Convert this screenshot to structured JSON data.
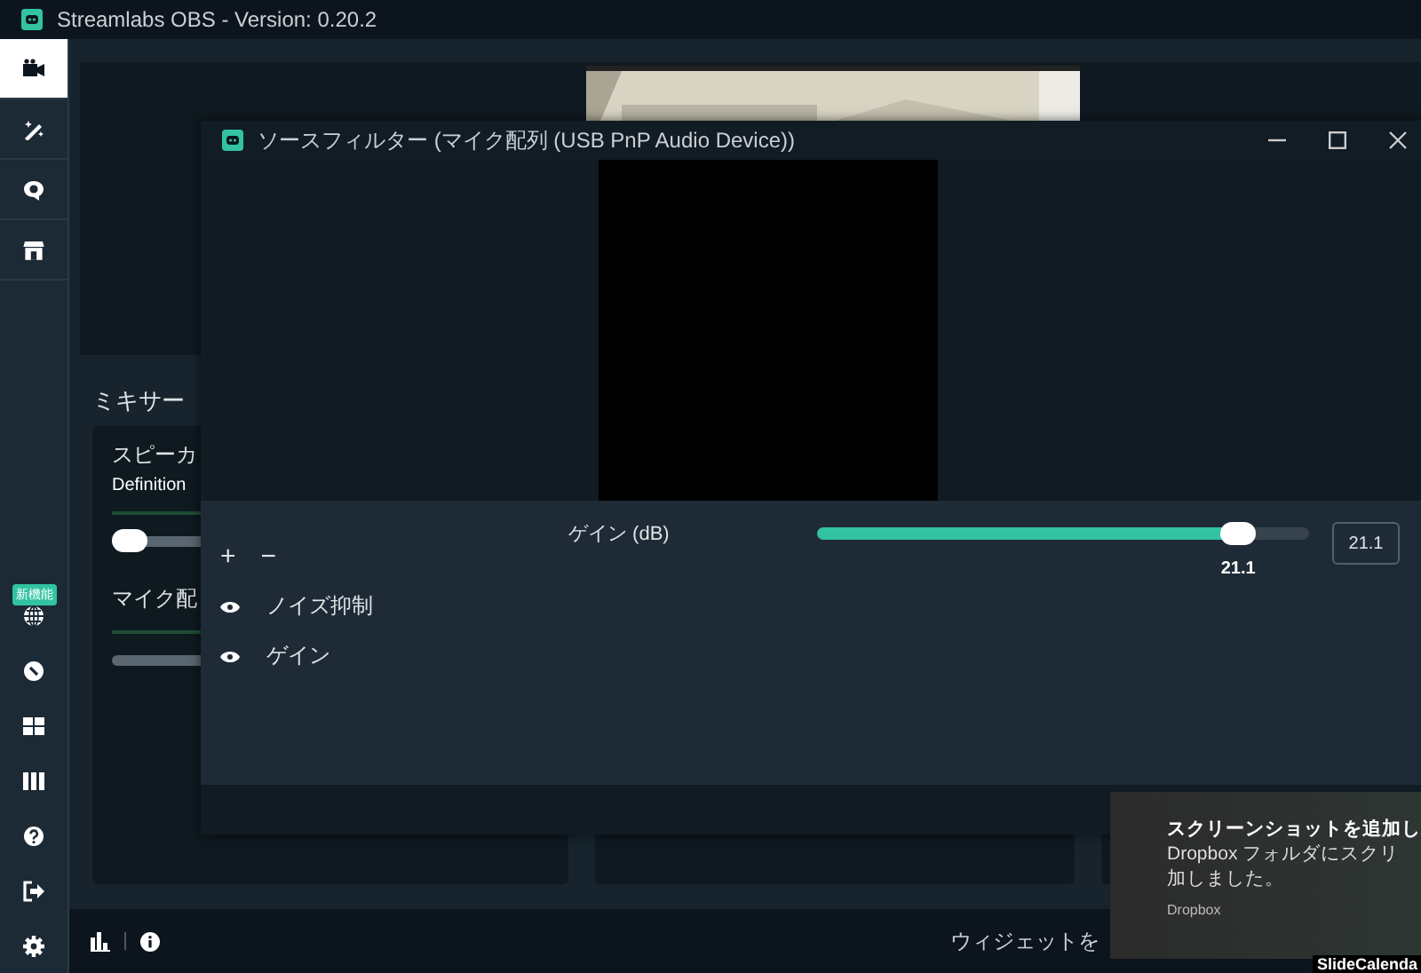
{
  "window": {
    "title": "Streamlabs OBS - Version: 0.20.2"
  },
  "sidebar": {
    "nav": [
      {
        "selected": true
      },
      {
        "selected": false
      },
      {
        "selected": false
      },
      {
        "selected": false
      }
    ],
    "badge": "新機能"
  },
  "mixer": {
    "title": "ミキサー",
    "sources": [
      {
        "name": "スピーカ",
        "device": "Definition",
        "level": 0
      },
      {
        "name": "マイク配"
      }
    ]
  },
  "dialog": {
    "title": "ソースフィルター (マイク配列 (USB PnP Audio Device))",
    "add": "+",
    "remove": "−",
    "filters": [
      {
        "name": "ノイズ抑制",
        "visible": true
      },
      {
        "name": "ゲイン",
        "visible": true
      }
    ],
    "setting": {
      "label": "ゲイン (dB)",
      "level": 0.856,
      "reading": "21.1",
      "value": "21.1"
    }
  },
  "bottom_bar": {
    "widget_text": "ウィジェットを"
  },
  "toast": {
    "title": "スクリーンショットを追加し",
    "lines": [
      "Dropbox フォルダにスクリ",
      "加しました。"
    ],
    "source": "Dropbox"
  },
  "taskbar_text": "SlideCalenda"
}
